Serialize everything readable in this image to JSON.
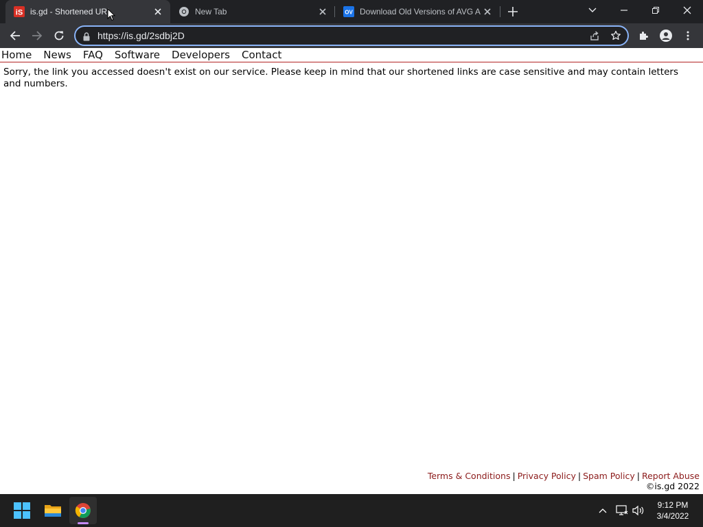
{
  "browser": {
    "tabs": [
      {
        "title": "is.gd - Shortened URL",
        "favicon": "isgd-favicon",
        "active": true
      },
      {
        "title": "New Tab",
        "favicon": "chrome-icon",
        "active": false
      },
      {
        "title": "Download Old Versions of AVG A",
        "favicon": "ov-favicon",
        "active": false
      }
    ],
    "ov_favicon_text": "OV",
    "isgd_favicon_text": "iS",
    "url": "https://is.gd/2sdbj2D"
  },
  "page": {
    "nav": [
      "Home",
      "News",
      "FAQ",
      "Software",
      "Developers",
      "Contact"
    ],
    "message": "Sorry, the link you accessed doesn't exist on our service. Please keep in mind that our shortened links are case sensitive and may contain letters and numbers.",
    "footer": {
      "links": [
        "Terms & Conditions",
        "Privacy Policy",
        "Spam Policy",
        "Report Abuse"
      ],
      "separator": "|",
      "copyright": "©is.gd 2022"
    }
  },
  "taskbar": {
    "apps": [
      "windows-start-icon",
      "file-explorer-icon",
      "chrome-icon"
    ],
    "clock_time": "9:12 PM",
    "clock_date": "3/4/2022"
  },
  "colors": {
    "tabstrip": "#202124",
    "toolbar": "#35363a",
    "focus_ring": "#8ab4f8",
    "nav_rule": "#b22222",
    "footer_link": "#8b1a1a",
    "taskbar": "#1f1f1f"
  }
}
